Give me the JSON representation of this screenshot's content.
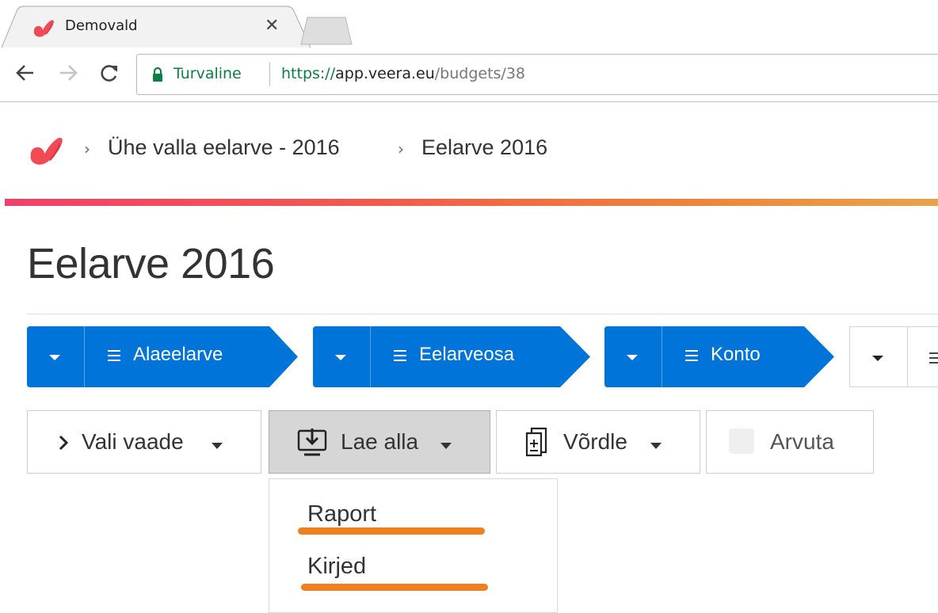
{
  "browser": {
    "tab": {
      "title": "Demovald",
      "close_label": "✕"
    },
    "address_bar": {
      "security_label": "Turvaline",
      "url_protocol": "https://",
      "url_host": "app.veera.eu",
      "url_path": "/budgets/38"
    }
  },
  "header": {
    "breadcrumb": [
      {
        "label": "Ühe valla eelarve - 2016"
      },
      {
        "label": "Eelarve 2016"
      }
    ],
    "separator": "›",
    "accent_gradient": [
      "#f2406a",
      "#f07f3a",
      "#e9a24c"
    ]
  },
  "page": {
    "title": "Eelarve 2016"
  },
  "dimensions": [
    {
      "label": "Alaeelarve"
    },
    {
      "label": "Eelarveosa"
    },
    {
      "label": "Konto"
    }
  ],
  "actions": {
    "view": {
      "label": "Vali vaade"
    },
    "download": {
      "label": "Lae alla"
    },
    "compare": {
      "label": "Võrdle"
    },
    "calculate": {
      "label": "Arvuta"
    }
  },
  "download_menu": {
    "items": [
      {
        "label": "Raport"
      },
      {
        "label": "Kirjed"
      }
    ],
    "highlight_color": "#f07f1f"
  },
  "colors": {
    "primary_blue": "#0074d9",
    "secure_green": "#0b8043"
  }
}
